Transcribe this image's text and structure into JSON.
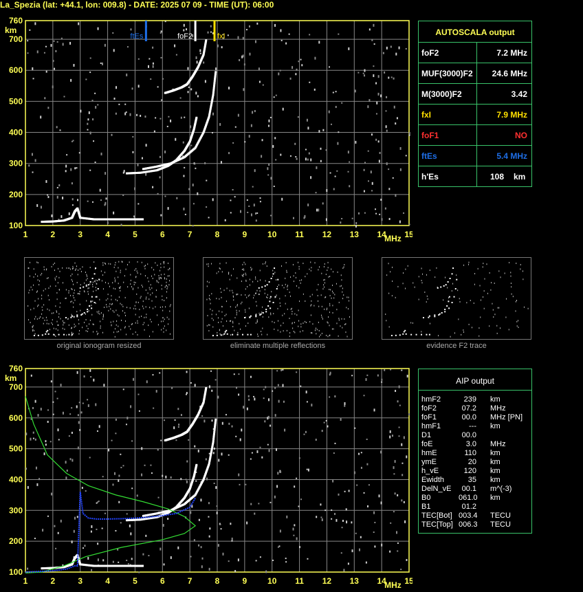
{
  "header": "La_Spezia (lat: +44.1, lon: 009.8) - DATE: 2025 07 09 - TIME (UT): 06:00",
  "colors": {
    "axis": "#ffff55",
    "grid": "#888888",
    "panel_border": "#39c46a",
    "trace": "#ffffff",
    "ftEs": "#1e6ee6",
    "fxI": "#ffe000",
    "foF1": "#ff3030",
    "profile": "#33dd33",
    "true_height": "#2244ff"
  },
  "top_chart": {
    "y_unit": "km",
    "x_unit": "MHz",
    "y_top_label": "760",
    "y_ticks": [
      "700",
      "600",
      "500",
      "400",
      "300",
      "200",
      "100"
    ],
    "x_ticks": [
      "1",
      "2",
      "3",
      "4",
      "5",
      "6",
      "7",
      "8",
      "9",
      "10",
      "11",
      "12",
      "13",
      "14",
      "15"
    ],
    "markers": {
      "ftEs": "ftEs",
      "foF2": "foF2",
      "fxI": "fxI"
    }
  },
  "bottom_chart": {
    "y_unit": "km",
    "x_unit": "MHz",
    "y_top_label": "760",
    "y_ticks": [
      "700",
      "600",
      "500",
      "400",
      "300",
      "200",
      "100"
    ],
    "x_ticks": [
      "1",
      "2",
      "3",
      "4",
      "5",
      "6",
      "7",
      "8",
      "9",
      "10",
      "11",
      "12",
      "13",
      "14",
      "15"
    ]
  },
  "autoscala": {
    "title": "AUTOSCALA output",
    "rows": [
      {
        "label": "foF2",
        "value": "7.2 MHz"
      },
      {
        "label": "MUF(3000)F2",
        "value": "24.6 MHz"
      },
      {
        "label": "M(3000)F2",
        "value": "3.42"
      },
      {
        "label": "fxI",
        "value": "7.9 MHz"
      },
      {
        "label": "foF1",
        "value": "NO"
      },
      {
        "label": "ftEs",
        "value": "5.4 MHz"
      },
      {
        "label": "h'Es",
        "value": "108",
        "unit": "km"
      }
    ]
  },
  "thumbnails": {
    "captions": [
      "original ionogram resized",
      "eliminate multiple reflections",
      "evidence F2 trace"
    ]
  },
  "aip": {
    "title": "AIP output",
    "rows": [
      {
        "name": "hmF2",
        "value": "239",
        "unit": "km"
      },
      {
        "name": "foF2",
        "value": "07.2",
        "unit": "MHz"
      },
      {
        "name": "foF1",
        "value": "00.0",
        "unit": "MHz   [PN]"
      },
      {
        "name": "hmF1",
        "value": "---",
        "unit": "km"
      },
      {
        "name": "D1",
        "value": "00.0",
        "unit": ""
      },
      {
        "name": "foE",
        "value": "3.0",
        "unit": "MHz"
      },
      {
        "name": "hmE",
        "value": "110",
        "unit": "km"
      },
      {
        "name": "ymE",
        "value": "20",
        "unit": "km"
      },
      {
        "name": "h_vE",
        "value": "120",
        "unit": "km"
      },
      {
        "name": "Ewidth",
        "value": "35",
        "unit": "km"
      },
      {
        "name": "DelN_vE",
        "value": "00.1",
        "unit": "m^(-3)"
      },
      {
        "name": "B0",
        "value": "061.0",
        "unit": "km"
      },
      {
        "name": "B1",
        "value": "01.2",
        "unit": ""
      },
      {
        "name": "TEC[Bot]",
        "value": "003.4",
        "unit": "TECU"
      },
      {
        "name": "TEC[Top]",
        "value": "006.3",
        "unit": "TECU"
      }
    ]
  },
  "chart_data": [
    {
      "type": "scatter",
      "xlabel": "MHz",
      "ylabel": "km",
      "xlim": [
        1,
        15
      ],
      "ylim": [
        100,
        760
      ],
      "grid": true,
      "series": [
        {
          "name": "E/Es trace",
          "x": [
            1.6,
            2.0,
            2.4,
            2.7,
            2.8,
            2.9,
            3.0,
            3.5,
            4.0,
            4.5,
            5.0,
            5.3
          ],
          "y": [
            112,
            113,
            116,
            125,
            145,
            155,
            125,
            120,
            120,
            120,
            120,
            120
          ]
        },
        {
          "name": "F ordinary",
          "x": [
            4.7,
            5.2,
            5.8,
            6.2,
            6.5,
            6.8,
            7.0,
            7.15,
            7.25
          ],
          "y": [
            268,
            270,
            278,
            292,
            310,
            340,
            370,
            410,
            450
          ]
        },
        {
          "name": "F extraordinary",
          "x": [
            5.3,
            5.8,
            6.3,
            6.8,
            7.2,
            7.5,
            7.7,
            7.85,
            7.95
          ],
          "y": [
            282,
            290,
            300,
            320,
            350,
            400,
            450,
            520,
            600
          ]
        },
        {
          "name": "second hop",
          "x": [
            6.1,
            6.4,
            6.7,
            6.9,
            7.1,
            7.3,
            7.5,
            7.6
          ],
          "y": [
            527,
            535,
            545,
            555,
            580,
            610,
            650,
            700
          ]
        }
      ],
      "markers": [
        {
          "label": "ftEs",
          "x": 5.4
        },
        {
          "label": "foF2",
          "x": 7.2
        },
        {
          "label": "fxI",
          "x": 7.9
        }
      ]
    },
    {
      "type": "line",
      "xlabel": "MHz",
      "ylabel": "km",
      "xlim": [
        1,
        15
      ],
      "ylim": [
        100,
        760
      ],
      "grid": true,
      "series": [
        {
          "name": "F ordinary",
          "x": [
            4.7,
            5.2,
            5.8,
            6.2,
            6.5,
            6.8,
            7.0,
            7.15,
            7.25
          ],
          "y": [
            268,
            270,
            278,
            292,
            310,
            340,
            370,
            410,
            450
          ]
        },
        {
          "name": "F extraordinary",
          "x": [
            5.3,
            5.8,
            6.3,
            6.8,
            7.2,
            7.5,
            7.7,
            7.85,
            7.95
          ],
          "y": [
            282,
            290,
            300,
            320,
            350,
            400,
            450,
            520,
            600
          ]
        },
        {
          "name": "second hop",
          "x": [
            6.1,
            6.4,
            6.7,
            6.9,
            7.1,
            7.3,
            7.5,
            7.6
          ],
          "y": [
            527,
            535,
            545,
            555,
            580,
            610,
            650,
            700
          ]
        },
        {
          "name": "E/Es trace",
          "x": [
            1.6,
            2.0,
            2.4,
            2.7,
            2.8,
            2.9,
            3.0,
            3.5,
            4.0,
            4.5,
            5.0,
            5.3
          ],
          "y": [
            112,
            113,
            116,
            125,
            145,
            155,
            125,
            120,
            120,
            120,
            120,
            120
          ]
        },
        {
          "name": "electron density profile",
          "x": [
            1.0,
            1.3,
            1.8,
            2.5,
            3.3,
            4.3,
            5.3,
            6.2,
            6.8,
            7.2,
            6.8,
            6.0,
            4.5,
            3.2,
            2.4,
            1.9,
            1.6,
            1.2,
            1.0
          ],
          "y": [
            670,
            580,
            480,
            420,
            380,
            350,
            328,
            305,
            280,
            250,
            225,
            205,
            180,
            150,
            120,
            108,
            100,
            98,
            97
          ]
        },
        {
          "name": "true height",
          "x": [
            1.0,
            1.5,
            2.0,
            2.5,
            2.8,
            2.9,
            3.0,
            3.1,
            3.3,
            3.6,
            4.0,
            4.5,
            5.0,
            5.5,
            6.0,
            6.5,
            7.0,
            7.2
          ],
          "y": [
            100,
            102,
            104,
            110,
            120,
            120,
            360,
            290,
            275,
            272,
            272,
            273,
            275,
            278,
            283,
            290,
            310,
            340
          ]
        }
      ]
    }
  ]
}
